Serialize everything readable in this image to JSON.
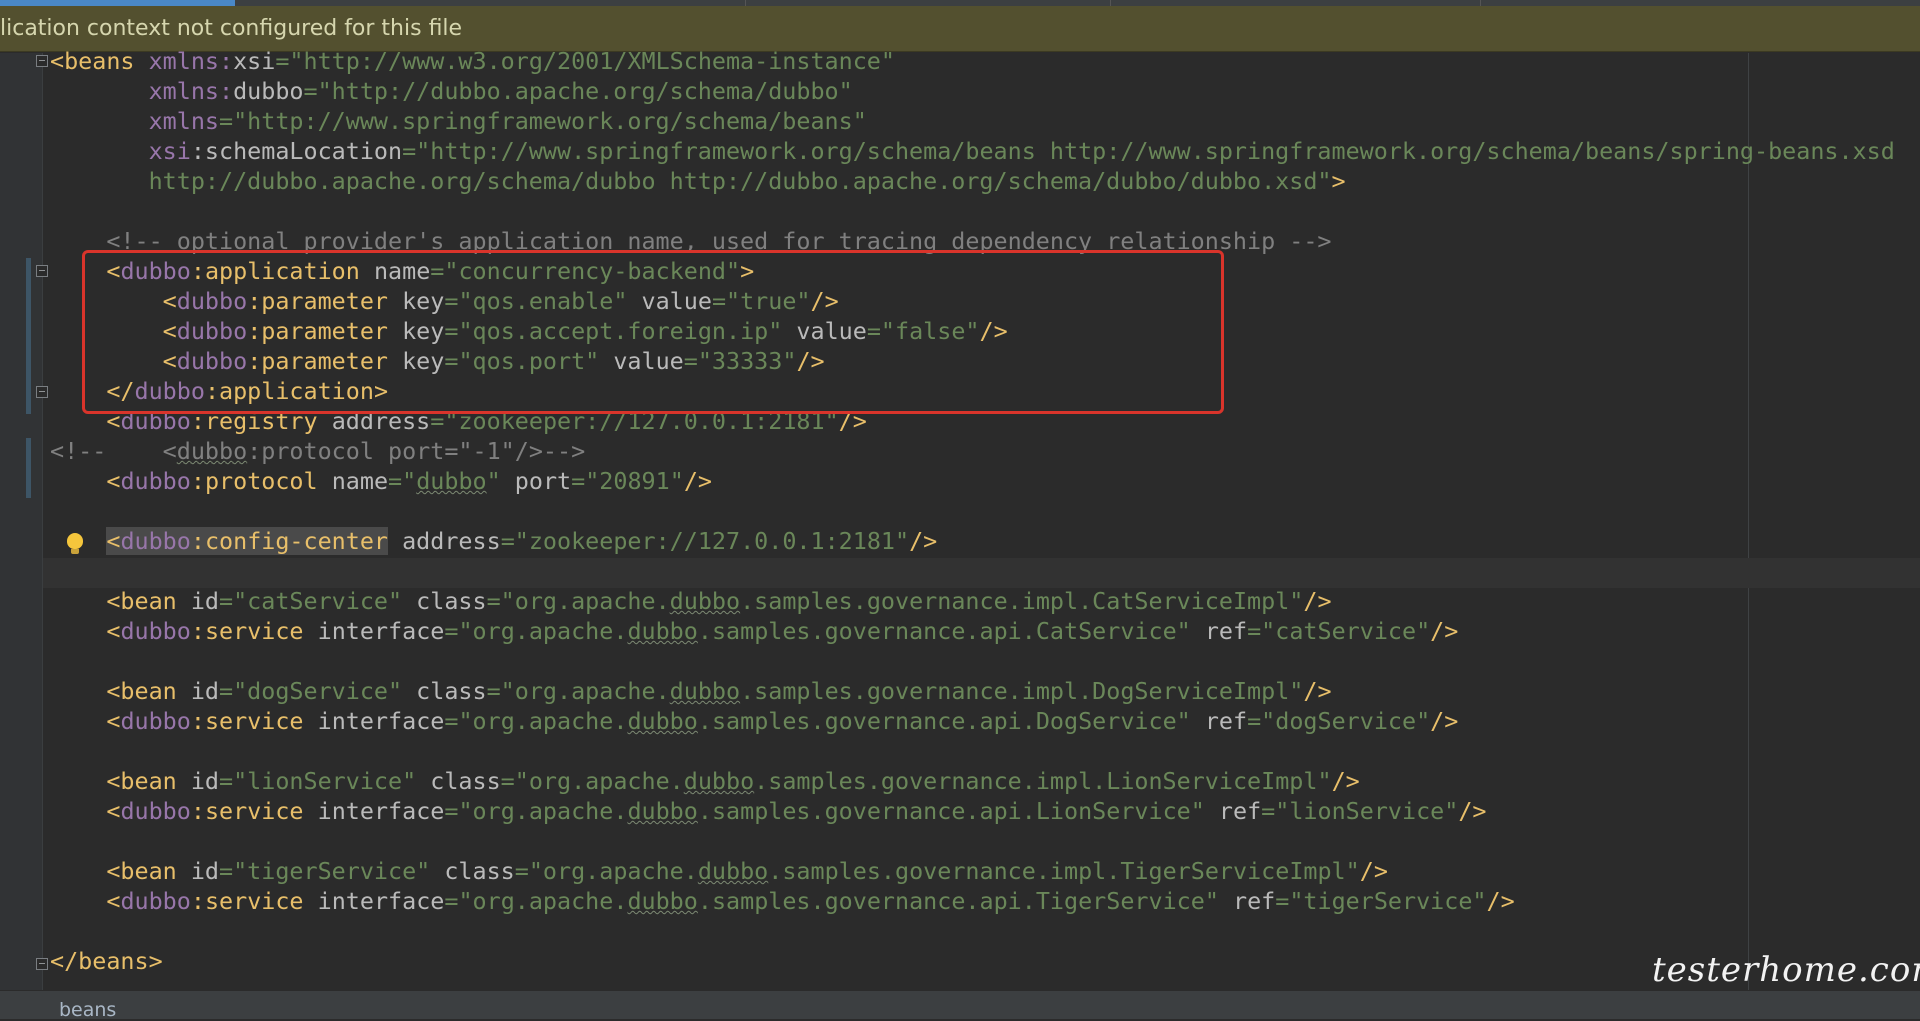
{
  "notice": "lication context not configured for this file",
  "status": {
    "breadcrumb": "beans"
  },
  "watermark": "testerhome.com",
  "lines": {
    "l01": {
      "t1": "<beans",
      "n1": "xmlns:",
      "a1": "xsi",
      "v1": "=\"http://www.w3.org/2001/XMLSchema-instance\""
    },
    "l02": {
      "n1": "xmlns:",
      "a1": "dubbo",
      "v1": "=\"http://dubbo.apache.org/schema/dubbo\""
    },
    "l03": {
      "n1": "xmlns",
      "v1": "=\"http://www.springframework.org/schema/beans\""
    },
    "l04": {
      "n1": "xsi",
      "a1": ":schemaLocation",
      "v1": "=\"http://www.springframework.org/schema/beans http://www.springframework.org/schema/beans/spring-beans.xsd"
    },
    "l05": {
      "v1": "http://dubbo.apache.org/schema/dubbo http://dubbo.apache.org/schema/dubbo/dubbo.xsd\"",
      "t1": ">"
    },
    "l07": {
      "c1": "<!-- optional provider's application name, used for tracing dependency relationship -->"
    },
    "l08": {
      "t1": "<",
      "n1": "dubbo",
      "t2": ":application",
      "a1": " name",
      "v1": "=\"concurrency-backend\"",
      "t3": ">"
    },
    "l09": {
      "t1": "<",
      "n1": "dubbo",
      "t2": ":parameter",
      "a1": " key",
      "v1": "=\"qos.enable\"",
      "a2": " value",
      "v2": "=\"true\"",
      "t3": "/>"
    },
    "l10": {
      "t1": "<",
      "n1": "dubbo",
      "t2": ":parameter",
      "a1": " key",
      "v1": "=\"qos.accept.foreign.ip\"",
      "a2": " value",
      "v2": "=\"false\"",
      "t3": "/>"
    },
    "l11": {
      "t1": "<",
      "n1": "dubbo",
      "t2": ":parameter",
      "a1": " key",
      "v1": "=\"qos.port\"",
      "a2": " value",
      "v2": "=\"33333\"",
      "t3": "/>"
    },
    "l12": {
      "t1": "</",
      "n1": "dubbo",
      "t2": ":application",
      "t3": ">"
    },
    "l13": {
      "t1": "<",
      "n1": "dubbo",
      "t2": ":registry",
      "a1": " address",
      "v1": "=\"zookeeper://127.0.0.1:2181\"",
      "t3": "/>"
    },
    "l14": {
      "c1": "<!--    <",
      "n1": "dubbo",
      "c2": ":protocol port=\"-1\"/>-->"
    },
    "l15": {
      "t1": "<",
      "n1": "dubbo",
      "t2": ":protocol",
      "a1": " name",
      "v1": "=\"",
      "u1": "dubbo",
      "v2": "\"",
      "a2": " port",
      "v3": "=\"20891\"",
      "t3": "/>"
    },
    "l17": {
      "t1": "<",
      "n1": "dubbo",
      "t2": ":config-center",
      "a1": " address",
      "v1": "=\"zookeeper://127.0.0.1:2181\"",
      "t3": "/>"
    },
    "l19": {
      "t1": "<bean",
      "a1": " id",
      "v1": "=\"catService\"",
      "a2": " class",
      "v2": "=\"org.apache.",
      "u1": "dubbo",
      "v3": ".samples.governance.impl.CatServiceImpl\"",
      "t2": "/>"
    },
    "l20": {
      "t1": "<",
      "n1": "dubbo",
      "t2": ":service",
      "a1": " interface",
      "v1": "=\"org.apache.",
      "u1": "dubbo",
      "v2": ".samples.governance.api.CatService\"",
      "a2": " ref",
      "v3": "=\"catService\"",
      "t3": "/>"
    },
    "l22": {
      "t1": "<bean",
      "a1": " id",
      "v1": "=\"dogService\"",
      "a2": " class",
      "v2": "=\"org.apache.",
      "u1": "dubbo",
      "v3": ".samples.governance.impl.DogServiceImpl\"",
      "t2": "/>"
    },
    "l23": {
      "t1": "<",
      "n1": "dubbo",
      "t2": ":service",
      "a1": " interface",
      "v1": "=\"org.apache.",
      "u1": "dubbo",
      "v2": ".samples.governance.api.DogService\"",
      "a2": " ref",
      "v3": "=\"dogService\"",
      "t3": "/>"
    },
    "l25": {
      "t1": "<bean",
      "a1": " id",
      "v1": "=\"lionService\"",
      "a2": " class",
      "v2": "=\"org.apache.",
      "u1": "dubbo",
      "v3": ".samples.governance.impl.LionServiceImpl\"",
      "t2": "/>"
    },
    "l26": {
      "t1": "<",
      "n1": "dubbo",
      "t2": ":service",
      "a1": " interface",
      "v1": "=\"org.apache.",
      "u1": "dubbo",
      "v2": ".samples.governance.api.LionService\"",
      "a2": " ref",
      "v3": "=\"lionService\"",
      "t3": "/>"
    },
    "l28": {
      "t1": "<bean",
      "a1": " id",
      "v1": "=\"tigerService\"",
      "a2": " class",
      "v2": "=\"org.apache.",
      "u1": "dubbo",
      "v3": ".samples.governance.impl.TigerServiceImpl\"",
      "t2": "/>"
    },
    "l29": {
      "t1": "<",
      "n1": "dubbo",
      "t2": ":service",
      "a1": " interface",
      "v1": "=\"org.apache.",
      "u1": "dubbo",
      "v2": ".samples.governance.api.TigerService\"",
      "a2": " ref",
      "v3": "=\"tigerService\"",
      "t3": "/>"
    },
    "l31": {
      "t1": "</beans>"
    }
  }
}
